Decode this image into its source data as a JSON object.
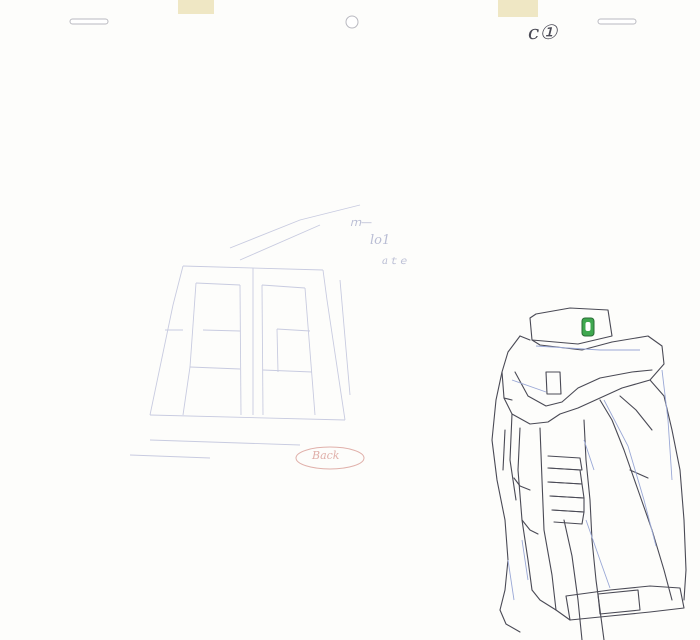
{
  "sheet": {
    "paper_color": "#fdfdfb",
    "tape_color": "#efe7c4",
    "pencil_color": "#4a4a55",
    "blue_pencil_color": "#9aa8d6",
    "red_pencil_color": "#e0b0aa",
    "green_color": "#3fa84f"
  },
  "labels": {
    "cut_number": "c①",
    "bg_note_top": "ｍ—",
    "bg_note_mid": "lo1",
    "bg_note_low": "aｔｅ",
    "bg_circled_note": "Back"
  }
}
